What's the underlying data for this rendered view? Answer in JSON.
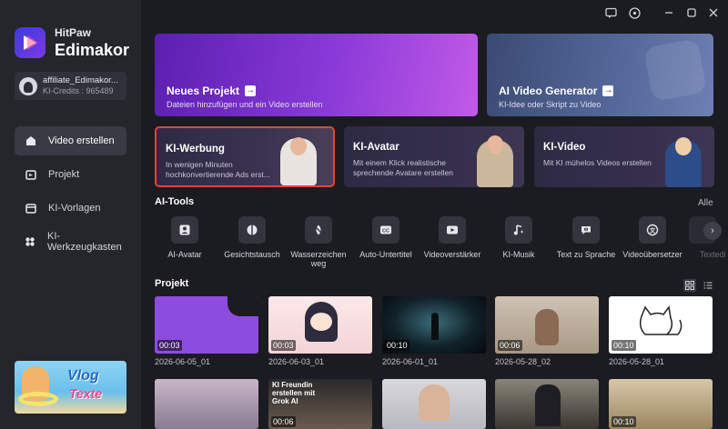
{
  "app": {
    "brand_small": "HitPaw",
    "brand_big": "Edimakor"
  },
  "account": {
    "name": "affiliate_Edimakor...",
    "credits": "KI-Credits : 965489"
  },
  "sidebar": {
    "items": [
      {
        "label": "Video erstellen",
        "icon": "home-icon",
        "active": true
      },
      {
        "label": "Projekt",
        "icon": "project-icon",
        "active": false
      },
      {
        "label": "KI-Vorlagen",
        "icon": "template-icon",
        "active": false
      },
      {
        "label": "KI-Werkzeugkasten",
        "icon": "toolbox-icon",
        "active": false
      }
    ]
  },
  "promo": {
    "line1": "Vlog",
    "line2": "Texte"
  },
  "hero": {
    "new_project": {
      "title": "Neues Projekt",
      "subtitle": "Dateien hinzufügen und ein Video erstellen"
    },
    "ai_video": {
      "title": "AI Video Generator",
      "subtitle": "KI-Idee oder Skript zu Video"
    }
  },
  "features": [
    {
      "title": "KI-Werbung",
      "subtitle": "In wenigen Minuten hochkonvertierende Ads erst..."
    },
    {
      "title": "KI-Avatar",
      "subtitle": "Mit einem Klick realistische sprechende Avatare erstellen"
    },
    {
      "title": "KI-Video",
      "subtitle": "Mit KI mühelos Videos erstellen"
    }
  ],
  "ai_tools": {
    "title": "AI-Tools",
    "all_label": "Alle",
    "items": [
      {
        "label": "AI-Avatar",
        "icon": "avatar-icon"
      },
      {
        "label": "Gesichtstausch",
        "icon": "face-swap-icon"
      },
      {
        "label": "Wasserzeichen weg",
        "icon": "watermark-remove-icon"
      },
      {
        "label": "Auto-Untertitel",
        "icon": "subtitle-icon"
      },
      {
        "label": "Videoverstärker",
        "icon": "video-enhance-icon"
      },
      {
        "label": "KI-Musik",
        "icon": "music-icon"
      },
      {
        "label": "Text zu Sprache",
        "icon": "speech-icon"
      },
      {
        "label": "Videoübersetzer",
        "icon": "translate-icon"
      },
      {
        "label": "Textedi",
        "icon": "text-edit-icon"
      }
    ]
  },
  "projects": {
    "title": "Projekt",
    "items": [
      {
        "duration": "00:03",
        "date": "2026-06-05_01"
      },
      {
        "duration": "00:03",
        "date": "2026-06-03_01"
      },
      {
        "duration": "00:10",
        "date": "2026-06-01_01"
      },
      {
        "duration": "00:06",
        "date": "2026-05-28_02"
      },
      {
        "duration": "00:10",
        "date": "2026-05-28_01"
      }
    ],
    "row2": [
      {
        "duration": "",
        "overlay": ""
      },
      {
        "duration": "00:06",
        "overlay": "KI Freundin erstellen mit Grok AI"
      },
      {
        "duration": "",
        "overlay": ""
      },
      {
        "duration": "",
        "overlay": ""
      },
      {
        "duration": "00:10",
        "overlay": ""
      }
    ]
  },
  "colors": {
    "accent": "#8a3ad8",
    "highlight_border": "#e0463a",
    "background": "#1b1b22",
    "sidebar": "#25252c"
  }
}
